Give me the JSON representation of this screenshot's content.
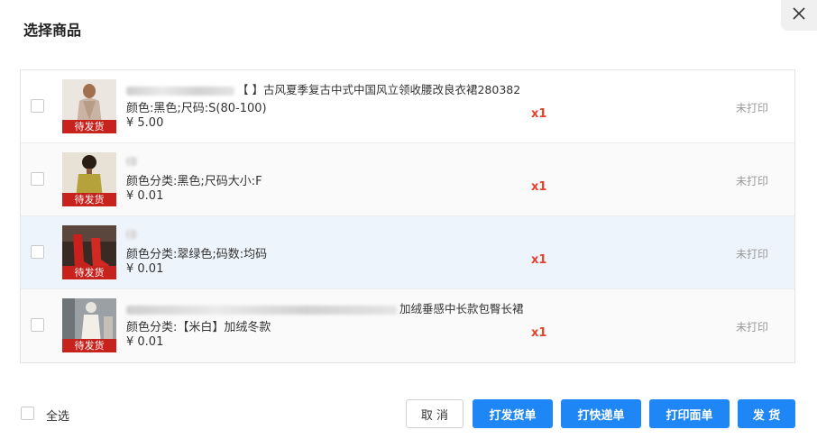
{
  "dialog": {
    "title": "选择商品"
  },
  "items": [
    {
      "name": "【 】古风夏季复古中式中国风立领收腰改良衣裙280382",
      "spec": "颜色:黑色;尺码:S(80-100)",
      "price": "¥ 5.00",
      "qty": "x1",
      "status": "未打印",
      "badge": "待发货"
    },
    {
      "name": "",
      "spec": "颜色分类:黑色;尺码大小:F",
      "price": "¥ 0.01",
      "qty": "x1",
      "status": "未打印",
      "badge": "待发货"
    },
    {
      "name": "",
      "spec": "颜色分类:翠绿色;码数:均码",
      "price": "¥ 0.01",
      "qty": "x1",
      "status": "未打印",
      "badge": "待发货"
    },
    {
      "name": "加绒垂感中长款包臀长裙",
      "spec": "颜色分类:【米白】加绒冬款",
      "price": "¥ 0.01",
      "qty": "x1",
      "status": "未打印",
      "badge": "待发货"
    }
  ],
  "footer": {
    "select_all": "全选",
    "cancel": "取 消",
    "print_ship_order": "打发货单",
    "print_express": "打快递单",
    "print_waybill": "打印面单",
    "ship": "发 货"
  },
  "colors": {
    "primary": "#1e86f5",
    "badge": "#c8221c",
    "qty": "#e4412b",
    "highlight_row": "#eef4fc"
  },
  "icons": {
    "close": "close-icon"
  }
}
